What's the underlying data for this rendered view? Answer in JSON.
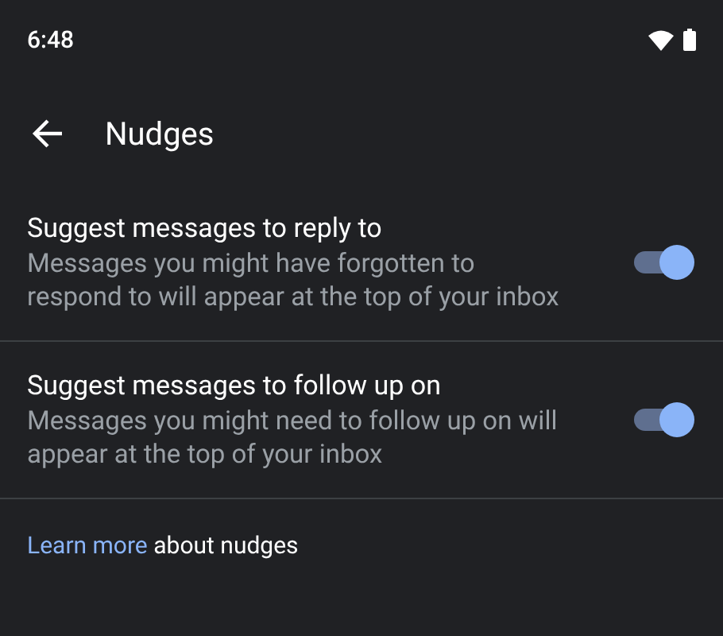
{
  "status_bar": {
    "time": "6:48"
  },
  "toolbar": {
    "title": "Nudges"
  },
  "settings": [
    {
      "title": "Suggest messages to reply to",
      "summary": "Messages you might have forgotten to respond to will appear at the top of your inbox",
      "on": true
    },
    {
      "title": "Suggest messages to follow up on",
      "summary": "Messages you might need to follow up on will appear at the top of your inbox",
      "on": true
    }
  ],
  "footer": {
    "link": "Learn more",
    "text": "about nudges"
  }
}
